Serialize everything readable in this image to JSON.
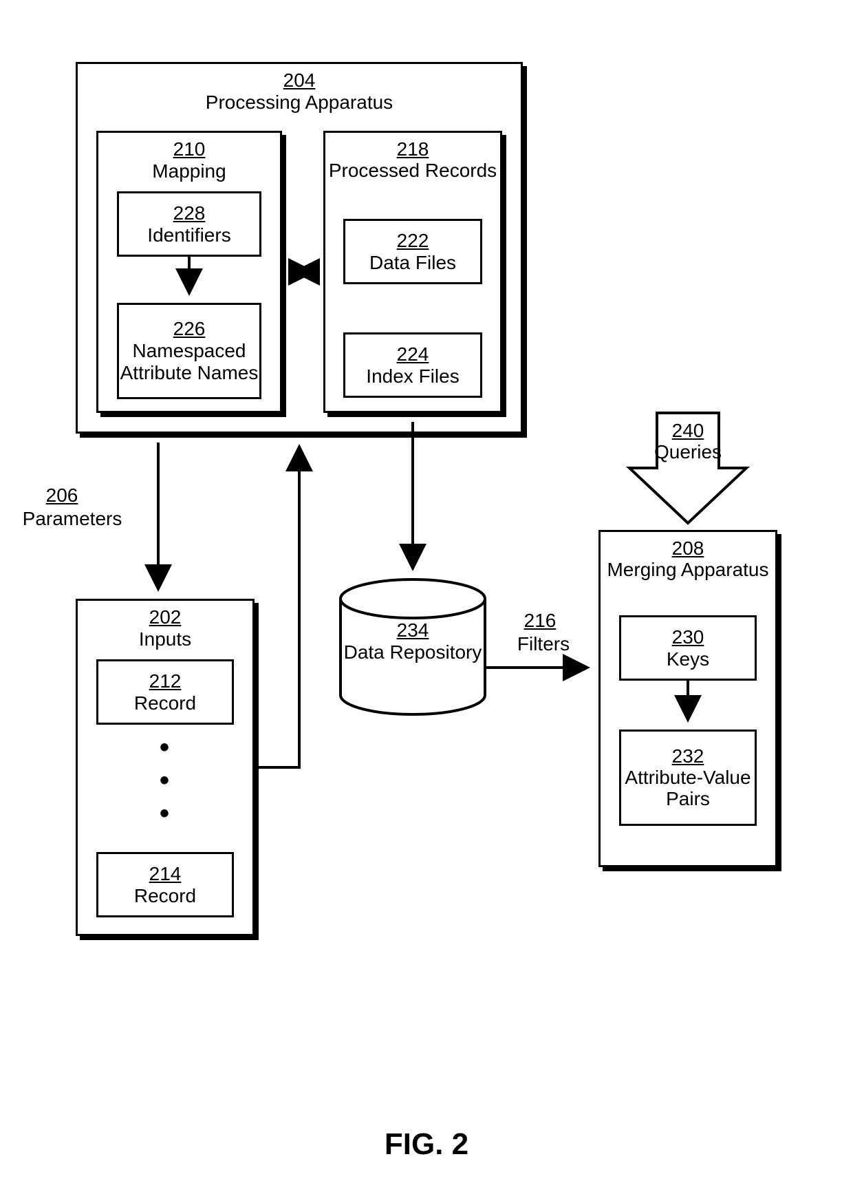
{
  "processing": {
    "num": "204",
    "label": "Processing Apparatus"
  },
  "mapping": {
    "num": "210",
    "label": "Mapping",
    "identifiers": {
      "num": "228",
      "label": "Identifiers"
    },
    "namespaced": {
      "num": "226",
      "label": "Namespaced Attribute Names"
    }
  },
  "processed": {
    "num": "218",
    "label": "Processed Records",
    "datafiles": {
      "num": "222",
      "label": "Data Files"
    },
    "indexfiles": {
      "num": "224",
      "label": "Index Files"
    }
  },
  "inputs": {
    "num": "202",
    "label": "Inputs",
    "record1": {
      "num": "212",
      "label": "Record"
    },
    "record2": {
      "num": "214",
      "label": "Record"
    }
  },
  "parameters": {
    "num": "206",
    "label": "Parameters"
  },
  "repo": {
    "num": "234",
    "label": "Data Repository"
  },
  "filters": {
    "num": "216",
    "label": "Filters"
  },
  "merging": {
    "num": "208",
    "label": "Merging Apparatus",
    "keys": {
      "num": "230",
      "label": "Keys"
    },
    "pairs": {
      "num": "232",
      "label": "Attribute-Value Pairs"
    }
  },
  "queries": {
    "num": "240",
    "label": "Queries"
  },
  "figure": "FIG. 2"
}
